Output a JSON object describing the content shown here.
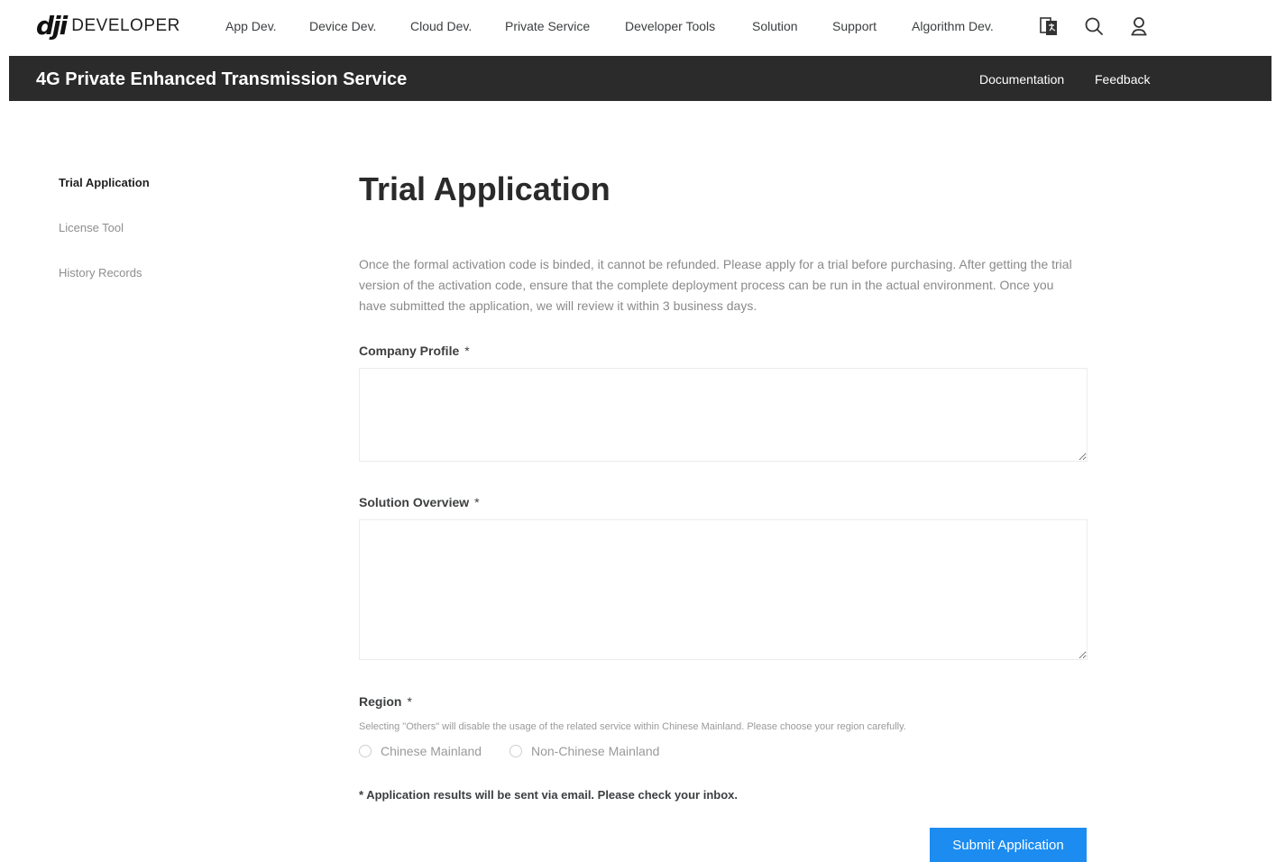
{
  "header": {
    "logo_mark": "dji",
    "logo_text": "DEVELOPER",
    "nav": [
      {
        "label": "App Dev."
      },
      {
        "label": "Device Dev."
      },
      {
        "label": "Cloud Dev."
      },
      {
        "label": "Private Service"
      },
      {
        "label": "Developer Tools"
      },
      {
        "label": "Solution"
      },
      {
        "label": "Support"
      },
      {
        "label": "Algorithm Dev."
      }
    ],
    "icons": [
      "language-icon",
      "search-icon",
      "user-icon"
    ]
  },
  "subbar": {
    "title": "4G Private Enhanced Transmission Service",
    "links": [
      {
        "label": "Documentation"
      },
      {
        "label": "Feedback"
      }
    ]
  },
  "sidebar": {
    "items": [
      {
        "label": "Trial Application",
        "active": true
      },
      {
        "label": "License Tool",
        "active": false
      },
      {
        "label": "History Records",
        "active": false
      }
    ]
  },
  "main": {
    "title": "Trial Application",
    "intro": "Once the formal activation code is binded, it cannot be refunded. Please apply for a trial before purchasing. After getting the trial version of the activation code, ensure that the complete deployment process can be run in the actual environment. Once you have submitted the application, we will review it within 3 business days.",
    "company_profile": {
      "label": "Company Profile",
      "required_mark": "*",
      "value": ""
    },
    "solution_overview": {
      "label": "Solution Overview",
      "required_mark": "*",
      "value": ""
    },
    "region": {
      "label": "Region",
      "required_mark": "*",
      "hint": "Selecting \"Others\" will disable the usage of the related service within Chinese Mainland. Please choose your region carefully.",
      "options": [
        {
          "label": "Chinese Mainland",
          "selected": false
        },
        {
          "label": "Non-Chinese Mainland",
          "selected": false
        }
      ]
    },
    "notice": "* Application results will be sent via email. Please check your inbox.",
    "submit_label": "Submit Application"
  },
  "colors": {
    "subbar_bg": "#2b2b2b",
    "accent": "#1c8cf0"
  }
}
